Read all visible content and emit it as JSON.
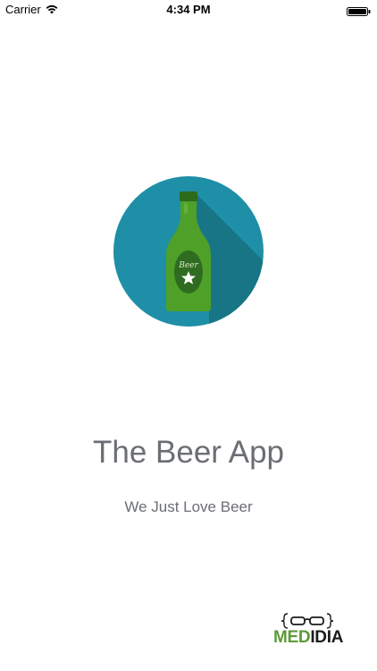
{
  "status_bar": {
    "carrier": "Carrier",
    "time": "4:34 PM",
    "wifi_icon": "wifi-icon",
    "battery_icon": "battery-full-icon"
  },
  "logo": {
    "icon": "beer-bottle-icon",
    "label_text": "Beer",
    "circle_color": "#1e8fa6",
    "bottle_color": "#52a32b"
  },
  "app": {
    "title": "The Beer App",
    "tagline": "We Just Love Beer"
  },
  "brand": {
    "part1": "MED",
    "part2": "IDIA",
    "icon": "glasses-braces-icon",
    "accent_color": "#5c9a3a"
  }
}
